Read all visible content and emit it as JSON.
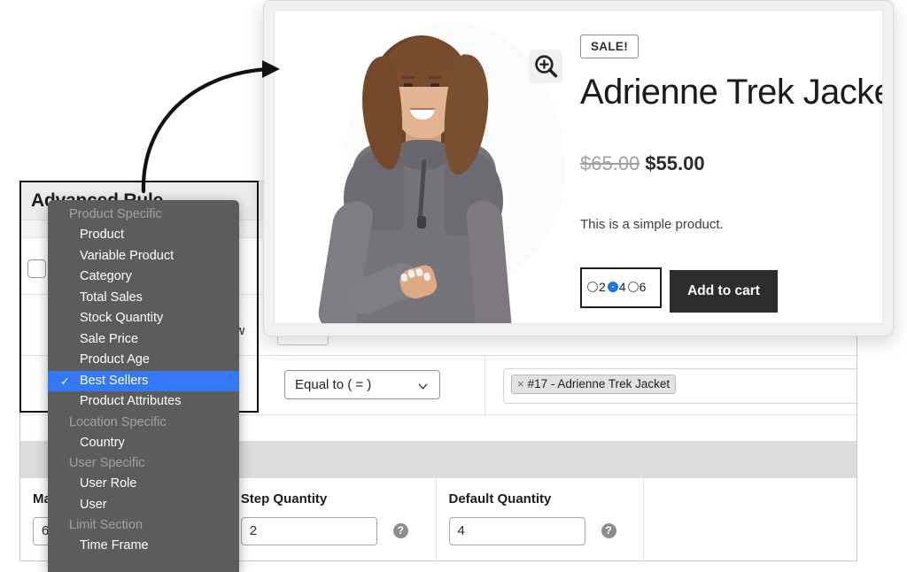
{
  "admin": {
    "title": "Advanced Rule",
    "helper_note": "below",
    "condition": {
      "operator_value": "Equal to ( = )",
      "operator_caret_icon": "chevron-down-icon",
      "product_token_remove_icon": "×",
      "product_token": "#17 - Adrienne Trek Jacket"
    },
    "quantity_fields": [
      {
        "label": "Max Quantity",
        "value": "6",
        "help_icon": "?"
      },
      {
        "label": "Step Quantity",
        "value": "2",
        "help_icon": "?"
      },
      {
        "label": "Default Quantity",
        "value": "4",
        "help_icon": "?"
      }
    ]
  },
  "dropdown": {
    "entries": [
      {
        "label": "Product Specific",
        "type": "group"
      },
      {
        "label": "Product",
        "type": "item"
      },
      {
        "label": "Variable Product",
        "type": "item"
      },
      {
        "label": "Category",
        "type": "item"
      },
      {
        "label": "Total Sales",
        "type": "item"
      },
      {
        "label": "Stock Quantity",
        "type": "item"
      },
      {
        "label": "Sale Price",
        "type": "item"
      },
      {
        "label": "Product Age",
        "type": "item"
      },
      {
        "label": "Best Sellers",
        "type": "item",
        "selected": true
      },
      {
        "label": "Product Attributes",
        "type": "item"
      },
      {
        "label": "Location Specific",
        "type": "group"
      },
      {
        "label": "Country",
        "type": "item"
      },
      {
        "label": "User Specific",
        "type": "group"
      },
      {
        "label": "User Role",
        "type": "item"
      },
      {
        "label": "User",
        "type": "item"
      },
      {
        "label": "Limit Section",
        "type": "group"
      },
      {
        "label": "Time Frame",
        "type": "item"
      }
    ],
    "selected_value": "Best Sellers",
    "check_icon": "✓",
    "highlight_color": "#3478f6",
    "background_color": "#5c5c5c"
  },
  "product_card": {
    "zoom_icon": "magnifier-plus-icon",
    "sale_badge": "SALE!",
    "title": "Adrienne Trek Jacket",
    "price_old": "$65.00",
    "price_new": "$55.00",
    "description": "This is a simple product.",
    "quantity_options": [
      "2",
      "4",
      "6"
    ],
    "quantity_selected": "4",
    "add_to_cart_label": "Add to cart",
    "accent_color": "#1577e5",
    "button_color": "#2d2d2d"
  }
}
